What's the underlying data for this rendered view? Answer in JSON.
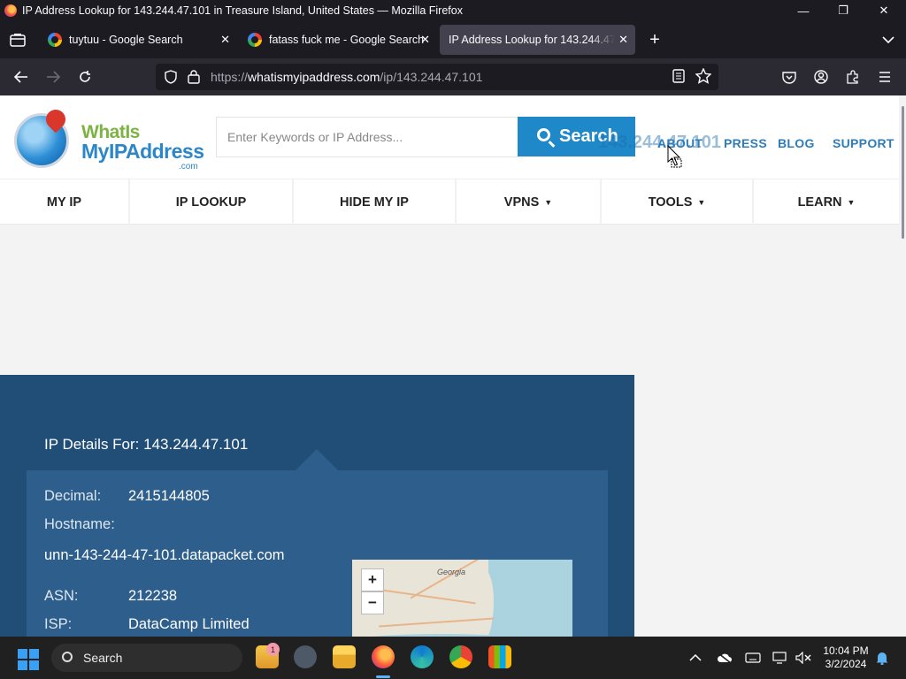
{
  "window": {
    "title": "IP Address Lookup for 143.244.47.101 in Treasure Island, United States — Mozilla Firefox",
    "minimize": "—",
    "maximize": "❐",
    "close": "✕"
  },
  "tabs": [
    {
      "label": "tuytuu - Google Search",
      "icon": "google-icon"
    },
    {
      "label": "fatass fuck me - Google Search",
      "icon": "google-icon"
    },
    {
      "label": "IP Address Lookup for 143.244.47.101",
      "icon": "none",
      "active": true
    }
  ],
  "nav": {
    "url_proto": "https://",
    "url_host": "whatismyipaddress.com",
    "url_path": "/ip/143.244.47.101"
  },
  "site": {
    "logo_what": "WhatIs",
    "logo_my": "MyIPAddress",
    "logo_com": ".com",
    "search_placeholder": "Enter Keywords or IP Address...",
    "search_button": "Search",
    "ghost_ip": "143.244.47.101",
    "top_links": [
      "ABOUT",
      "PRESS",
      "BLOG",
      "SUPPORT"
    ],
    "main_nav": [
      {
        "label": "MY IP",
        "caret": ""
      },
      {
        "label": "IP LOOKUP",
        "caret": ""
      },
      {
        "label": "HIDE MY IP",
        "caret": ""
      },
      {
        "label": "VPNS",
        "caret": "▼"
      },
      {
        "label": "TOOLS",
        "caret": "▼"
      },
      {
        "label": "LEARN",
        "caret": "▼"
      }
    ]
  },
  "ip_details": {
    "title": "IP Details For: 143.244.47.101",
    "decimal_label": "Decimal:",
    "decimal_value": "2415144805",
    "hostname_label": "Hostname:",
    "hostname_value": "unn-143-244-47-101.datapacket.com",
    "asn_label": "ASN:",
    "asn_value": "212238",
    "isp_label": "ISP:",
    "isp_value": "DataCamp Limited"
  },
  "map": {
    "state_label": "Georgia",
    "zoom_in": "+",
    "zoom_out": "−"
  },
  "taskbar": {
    "search_label": "Search",
    "notification_count": "1",
    "time": "10:04 PM",
    "date": "3/2/2024"
  },
  "colors": {
    "brand_blue": "#1e88c8",
    "panel_dark": "#214e77",
    "panel_card": "#2e5f8c",
    "link_blue": "#2e7db8"
  }
}
